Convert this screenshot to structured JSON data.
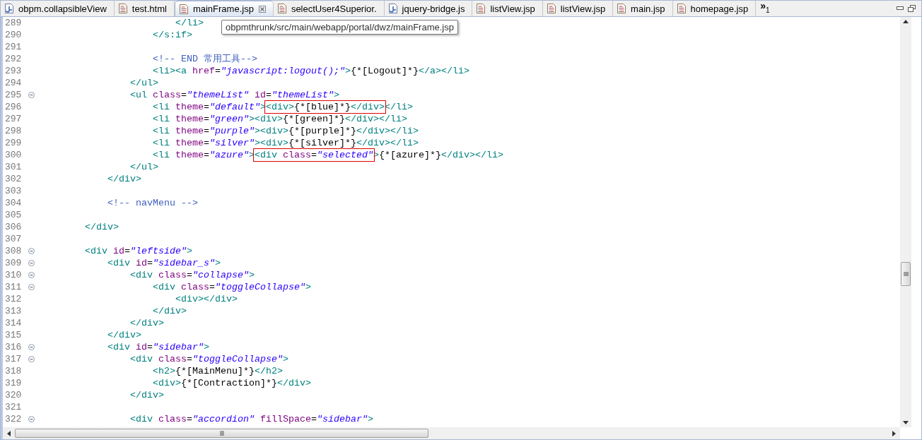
{
  "tabs": [
    {
      "label": "obpm.collapsibleView",
      "kind": "script",
      "selected": false
    },
    {
      "label": "test.html",
      "kind": "page",
      "selected": false
    },
    {
      "label": "mainFrame.jsp",
      "kind": "page",
      "selected": true
    },
    {
      "label": "selectUser4Superior.",
      "kind": "page",
      "selected": false
    },
    {
      "label": "jquery-bridge.js",
      "kind": "script",
      "selected": false
    },
    {
      "label": "listView.jsp",
      "kind": "page",
      "selected": false
    },
    {
      "label": "listView.jsp",
      "kind": "page",
      "selected": false
    },
    {
      "label": "main.jsp",
      "kind": "page",
      "selected": false
    },
    {
      "label": "homepage.jsp",
      "kind": "page",
      "selected": false
    }
  ],
  "tab_overflow": {
    "symbol": "»",
    "count": "1"
  },
  "tooltip": "obpmthrunk/src/main/webapp/portal/dwz/mainFrame.jsp",
  "code_lines": [
    {
      "children": [
        {
          "children": [
            {
              "children": [
                {
                  "children": [
                    {
                      "number": "289",
                      "foldable": false,
                      "parts": [
                        {
                          "kind": "tag",
                          "text": "</li>"
                        }
                      ]
                    }
                  ]
                },
                {
                  "number": "290",
                  "foldable": false,
                  "parts": [
                    {
                      "kind": "tag",
                      "text": "</s:if>"
                    }
                  ]
                },
                {
                  "number": "291",
                  "foldable": false
                },
                {
                  "number": "292",
                  "foldable": false,
                  "parts": [
                    {
                      "kind": "comment",
                      "text": "<!-- END 常用工具-->"
                    }
                  ]
                },
                {
                  "number": "293",
                  "foldable": false,
                  "parts": [
                    {
                      "kind": "tag",
                      "text": "<li><a "
                    },
                    {
                      "kind": "attr",
                      "text": "href"
                    },
                    {
                      "kind": "text",
                      "text": "="
                    },
                    {
                      "kind": "value",
                      "text": "\"javascript:logout();\""
                    },
                    {
                      "kind": "tag",
                      "text": ">"
                    },
                    {
                      "kind": "text",
                      "text": "{*[Logout]*}"
                    },
                    {
                      "kind": "tag",
                      "text": "</a></li>"
                    }
                  ]
                }
              ]
            },
            {
              "number": "294",
              "foldable": false,
              "parts": [
                {
                  "kind": "tag",
                  "text": "</ul>"
                }
              ]
            },
            {
              "number": "295",
              "foldable": true,
              "parts": [
                {
                  "kind": "tag",
                  "text": "<ul "
                },
                {
                  "kind": "attr",
                  "text": "class"
                },
                {
                  "kind": "text",
                  "text": "="
                },
                {
                  "kind": "value",
                  "text": "\"themeList\""
                },
                {
                  "kind": "attr",
                  "text": " id"
                },
                {
                  "kind": "text",
                  "text": "="
                },
                {
                  "kind": "value",
                  "text": "\"themeList\""
                },
                {
                  "kind": "tag",
                  "text": ">"
                }
              ],
              "children": [
                {
                  "number": "296",
                  "foldable": false,
                  "parts": [
                    {
                      "kind": "tag",
                      "text": "<li "
                    },
                    {
                      "kind": "attr",
                      "text": "theme"
                    },
                    {
                      "kind": "text",
                      "text": "="
                    },
                    {
                      "kind": "value",
                      "text": "\"default\""
                    },
                    {
                      "kind": "tag",
                      "text": ">"
                    },
                    {
                      "kind": "marked",
                      "parts": [
                        {
                          "kind": "tag",
                          "text": "<div>"
                        },
                        {
                          "kind": "text",
                          "text": "{*[blue]*}"
                        },
                        {
                          "kind": "tag",
                          "text": "</div>"
                        }
                      ]
                    },
                    {
                      "kind": "tag",
                      "text": "</li>"
                    }
                  ]
                },
                {
                  "number": "297",
                  "foldable": false,
                  "parts": [
                    {
                      "kind": "tag",
                      "text": "<li "
                    },
                    {
                      "kind": "attr",
                      "text": "theme"
                    },
                    {
                      "kind": "text",
                      "text": "="
                    },
                    {
                      "kind": "value",
                      "text": "\"green\""
                    },
                    {
                      "kind": "tag",
                      "text": "><div>"
                    },
                    {
                      "kind": "text",
                      "text": "{*[green]*}"
                    },
                    {
                      "kind": "tag",
                      "text": "</div></li>"
                    }
                  ]
                },
                {
                  "number": "298",
                  "foldable": false,
                  "parts": [
                    {
                      "kind": "tag",
                      "text": "<li "
                    },
                    {
                      "kind": "attr",
                      "text": "theme"
                    },
                    {
                      "kind": "text",
                      "text": "="
                    },
                    {
                      "kind": "value",
                      "text": "\"purple\""
                    },
                    {
                      "kind": "tag",
                      "text": "><div>"
                    },
                    {
                      "kind": "text",
                      "text": "{*[purple]*}"
                    },
                    {
                      "kind": "tag",
                      "text": "</div></li>"
                    }
                  ]
                },
                {
                  "number": "299",
                  "foldable": false,
                  "parts": [
                    {
                      "kind": "tag",
                      "text": "<li "
                    },
                    {
                      "kind": "attr",
                      "text": "theme"
                    },
                    {
                      "kind": "text",
                      "text": "="
                    },
                    {
                      "kind": "value",
                      "text": "\"silver\""
                    },
                    {
                      "kind": "tag",
                      "text": "><div>"
                    },
                    {
                      "kind": "text",
                      "text": "{*[silver]*}"
                    },
                    {
                      "kind": "tag",
                      "text": "</div></li>"
                    }
                  ]
                },
                {
                  "number": "300",
                  "foldable": false,
                  "parts": [
                    {
                      "kind": "tag",
                      "text": "<li "
                    },
                    {
                      "kind": "attr",
                      "text": "theme"
                    },
                    {
                      "kind": "text",
                      "text": "="
                    },
                    {
                      "kind": "value",
                      "text": "\"azure\""
                    },
                    {
                      "kind": "tag",
                      "text": ">"
                    },
                    {
                      "kind": "marked",
                      "parts": [
                        {
                          "kind": "tag",
                          "text": "<div "
                        },
                        {
                          "kind": "attr",
                          "text": "class"
                        },
                        {
                          "kind": "text",
                          "text": "="
                        },
                        {
                          "kind": "value",
                          "text": "\"selected\""
                        }
                      ]
                    },
                    {
                      "kind": "tag",
                      "text": ">"
                    },
                    {
                      "kind": "text",
                      "text": "{*[azure]*}"
                    },
                    {
                      "kind": "tag",
                      "text": "</div></li>"
                    }
                  ]
                }
              ]
            },
            {
              "number": "301",
              "foldable": false,
              "parts": [
                {
                  "kind": "tag",
                  "text": "</ul>"
                }
              ]
            }
          ]
        },
        {
          "number": "302",
          "foldable": false,
          "parts": [
            {
              "kind": "tag",
              "text": "</div>"
            }
          ]
        },
        {
          "number": "303",
          "foldable": false
        },
        {
          "number": "304",
          "foldable": false,
          "parts": [
            {
              "kind": "comment",
              "text": "<!-- navMenu -->"
            }
          ]
        },
        {
          "number": "305",
          "foldable": false
        }
      ]
    },
    {
      "number": "306",
      "foldable": false,
      "parts": [
        {
          "kind": "tag",
          "text": "</div>"
        }
      ]
    },
    {
      "number": "307",
      "foldable": false
    },
    {
      "number": "308",
      "foldable": true,
      "parts": [
        {
          "kind": "tag",
          "text": "<div "
        },
        {
          "kind": "attr",
          "text": "id"
        },
        {
          "kind": "text",
          "text": "="
        },
        {
          "kind": "value",
          "text": "\"leftside\""
        },
        {
          "kind": "tag",
          "text": ">"
        }
      ],
      "children": [
        {
          "number": "309",
          "foldable": true,
          "parts": [
            {
              "kind": "tag",
              "text": "<div "
            },
            {
              "kind": "attr",
              "text": "id"
            },
            {
              "kind": "text",
              "text": "="
            },
            {
              "kind": "value",
              "text": "\"sidebar_s\""
            },
            {
              "kind": "tag",
              "text": ">"
            }
          ],
          "children": [
            {
              "number": "310",
              "foldable": true,
              "parts": [
                {
                  "kind": "tag",
                  "text": "<div "
                },
                {
                  "kind": "attr",
                  "text": "class"
                },
                {
                  "kind": "text",
                  "text": "="
                },
                {
                  "kind": "value",
                  "text": "\"collapse\""
                },
                {
                  "kind": "tag",
                  "text": ">"
                }
              ],
              "children": [
                {
                  "number": "311",
                  "foldable": true,
                  "parts": [
                    {
                      "kind": "tag",
                      "text": "<div "
                    },
                    {
                      "kind": "attr",
                      "text": "class"
                    },
                    {
                      "kind": "text",
                      "text": "="
                    },
                    {
                      "kind": "value",
                      "text": "\"toggleCollapse\""
                    },
                    {
                      "kind": "tag",
                      "text": ">"
                    }
                  ],
                  "children": [
                    {
                      "number": "312",
                      "foldable": false,
                      "parts": [
                        {
                          "kind": "tag",
                          "text": "<div></div>"
                        }
                      ]
                    }
                  ]
                },
                {
                  "number": "313",
                  "foldable": false,
                  "parts": [
                    {
                      "kind": "tag",
                      "text": "</div>"
                    }
                  ]
                }
              ]
            },
            {
              "number": "314",
              "foldable": false,
              "parts": [
                {
                  "kind": "tag",
                  "text": "</div>"
                }
              ]
            }
          ]
        },
        {
          "number": "315",
          "foldable": false,
          "parts": [
            {
              "kind": "tag",
              "text": "</div>"
            }
          ]
        },
        {
          "number": "316",
          "foldable": true,
          "parts": [
            {
              "kind": "tag",
              "text": "<div "
            },
            {
              "kind": "attr",
              "text": "id"
            },
            {
              "kind": "text",
              "text": "="
            },
            {
              "kind": "value",
              "text": "\"sidebar\""
            },
            {
              "kind": "tag",
              "text": ">"
            }
          ],
          "children": [
            {
              "number": "317",
              "foldable": true,
              "parts": [
                {
                  "kind": "tag",
                  "text": "<div "
                },
                {
                  "kind": "attr",
                  "text": "class"
                },
                {
                  "kind": "text",
                  "text": "="
                },
                {
                  "kind": "value",
                  "text": "\"toggleCollapse\""
                },
                {
                  "kind": "tag",
                  "text": ">"
                }
              ],
              "children": [
                {
                  "number": "318",
                  "foldable": false,
                  "parts": [
                    {
                      "kind": "tag",
                      "text": "<h2>"
                    },
                    {
                      "kind": "text",
                      "text": "{*[MainMenu]*}"
                    },
                    {
                      "kind": "tag",
                      "text": "</h2>"
                    }
                  ]
                },
                {
                  "number": "319",
                  "foldable": false,
                  "parts": [
                    {
                      "kind": "tag",
                      "text": "<div>"
                    },
                    {
                      "kind": "text",
                      "text": "{*[Contraction]*}"
                    },
                    {
                      "kind": "tag",
                      "text": "</div>"
                    }
                  ]
                }
              ]
            },
            {
              "number": "320",
              "foldable": false,
              "parts": [
                {
                  "kind": "tag",
                  "text": "</div>"
                }
              ]
            },
            {
              "number": "321",
              "foldable": false
            },
            {
              "number": "322",
              "foldable": true,
              "parts": [
                {
                  "kind": "tag",
                  "text": "<div "
                },
                {
                  "kind": "attr",
                  "text": "class"
                },
                {
                  "kind": "text",
                  "text": "="
                },
                {
                  "kind": "value",
                  "text": "\"accordion\""
                },
                {
                  "kind": "attr",
                  "text": " fillSpace"
                },
                {
                  "kind": "text",
                  "text": "="
                },
                {
                  "kind": "value",
                  "text": "\"sidebar\""
                },
                {
                  "kind": "tag",
                  "text": ">"
                }
              ]
            }
          ]
        }
      ]
    }
  ]
}
